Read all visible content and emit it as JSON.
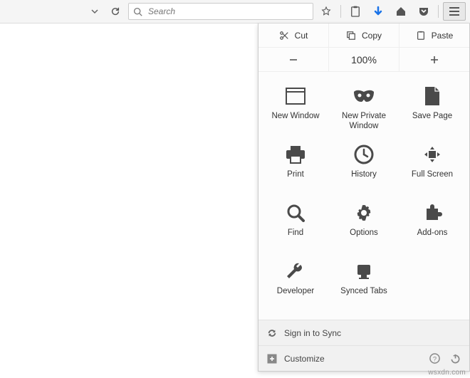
{
  "toolbar": {
    "search_placeholder": "Search"
  },
  "menu": {
    "edit": {
      "cut": "Cut",
      "copy": "Copy",
      "paste": "Paste"
    },
    "zoom": {
      "level": "100%"
    },
    "items": [
      {
        "label": "New Window"
      },
      {
        "label": "New Private Window"
      },
      {
        "label": "Save Page"
      },
      {
        "label": "Print"
      },
      {
        "label": "History"
      },
      {
        "label": "Full Screen"
      },
      {
        "label": "Find"
      },
      {
        "label": "Options"
      },
      {
        "label": "Add-ons"
      },
      {
        "label": "Developer"
      },
      {
        "label": "Synced Tabs"
      }
    ],
    "sign_in": "Sign in to Sync",
    "customize": "Customize"
  },
  "watermark": "wsxdn.com"
}
